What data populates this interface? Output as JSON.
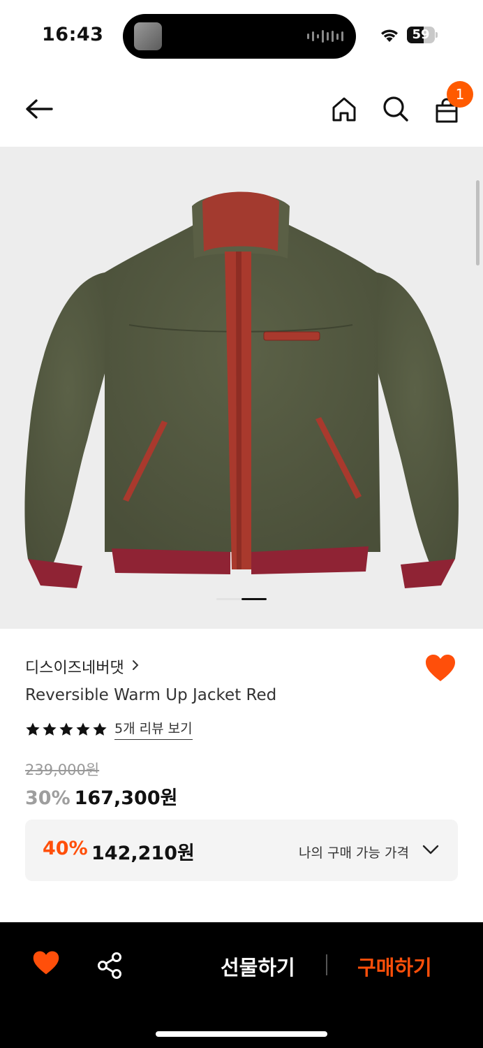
{
  "status_bar": {
    "time": "16:43",
    "battery": "59",
    "battery_level": 0.59
  },
  "nav": {
    "cart_badge": "1"
  },
  "gallery": {
    "image_description": "Olive fleece reversible jacket with red trim",
    "page_count": 2,
    "current_page": 2
  },
  "product": {
    "brand": "디스이즈네버댓",
    "brand_chevron": "›",
    "name": "Reversible Warm Up Jacket Red",
    "rating_stars": 5,
    "review_link": "5개 리뷰 보기",
    "original_price": "239,000원",
    "discount": "30%",
    "sale_price": "167,300원",
    "liked": true
  },
  "my_price": {
    "discount": "40%",
    "price": "142,210원",
    "label": "나의 구매 가능 가격"
  },
  "bottom_bar": {
    "gift_label": "선물하기",
    "buy_label": "구매하기"
  },
  "colors": {
    "accent": "#ff4f0a",
    "badge": "#ff5a00",
    "heart": "#ff4f0a",
    "bottom_bar": "#000000",
    "gallery_bg": "#ededed"
  }
}
